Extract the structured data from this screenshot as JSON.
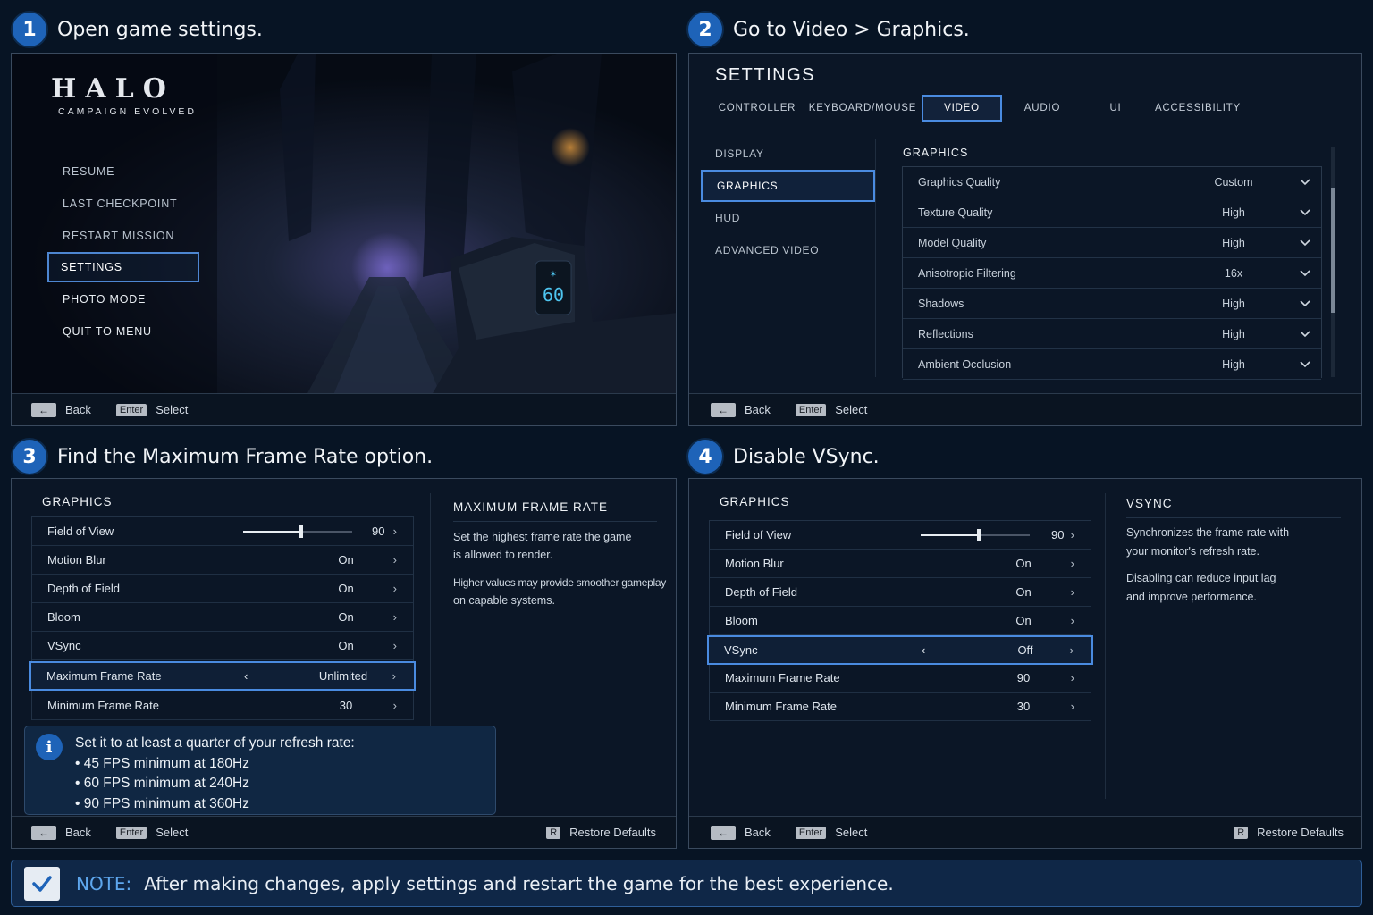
{
  "steps": [
    {
      "num": "1",
      "title": "Open game settings."
    },
    {
      "num": "2",
      "title": "Go to Video > Graphics."
    },
    {
      "num": "3",
      "title": "Find the Maximum Frame Rate option."
    },
    {
      "num": "4",
      "title": "Disable VSync."
    }
  ],
  "footer": {
    "back": "Back",
    "enter_key": "Enter",
    "select": "Select",
    "r_key": "R",
    "restore": "Restore Defaults"
  },
  "panel1": {
    "logo_title": "HALO",
    "logo_sub": "CAMPAIGN EVOLVED",
    "ammo": "60",
    "menu": [
      "RESUME",
      "LAST CHECKPOINT",
      "RESTART MISSION",
      "SETTINGS",
      "PHOTO MODE",
      "QUIT TO MENU"
    ]
  },
  "panel2": {
    "title": "SETTINGS",
    "tabs": [
      "CONTROLLER",
      "KEYBOARD/MOUSE",
      "VIDEO",
      "AUDIO",
      "UI",
      "ACCESSIBILITY"
    ],
    "side": [
      "DISPLAY",
      "GRAPHICS",
      "HUD",
      "ADVANCED VIDEO"
    ],
    "section": "GRAPHICS",
    "rows": [
      {
        "label": "Graphics Quality",
        "value": "Custom"
      },
      {
        "label": "Texture Quality",
        "value": "High"
      },
      {
        "label": "Model Quality",
        "value": "High"
      },
      {
        "label": "Anisotropic Filtering",
        "value": "16x"
      },
      {
        "label": "Shadows",
        "value": "High"
      },
      {
        "label": "Reflections",
        "value": "High"
      },
      {
        "label": "Ambient Occlusion",
        "value": "High"
      }
    ]
  },
  "panel3": {
    "section": "GRAPHICS",
    "rows": [
      {
        "label": "Field of View",
        "value": "90"
      },
      {
        "label": "Motion Blur",
        "value": "On"
      },
      {
        "label": "Depth of Field",
        "value": "On"
      },
      {
        "label": "Bloom",
        "value": "On"
      },
      {
        "label": "VSync",
        "value": "On"
      },
      {
        "label": "Maximum Frame Rate",
        "value": "Unlimited"
      },
      {
        "label": "Minimum Frame Rate",
        "value": "30"
      }
    ],
    "fov_slider_fraction": 0.53,
    "desc_title": "MAXIMUM FRAME RATE",
    "desc_1": "Set the highest frame rate the game",
    "desc_2": "is allowed to render.",
    "desc_3": "Higher values may provide smoother gameplay",
    "desc_4": "on capable systems.",
    "tip_title": "Set it to at least a quarter of your refresh rate:",
    "tips": [
      "• 45 FPS minimum at 180Hz",
      "• 60 FPS minimum at 240Hz",
      "• 90 FPS minimum at 360Hz"
    ]
  },
  "panel4": {
    "section": "GRAPHICS",
    "rows": [
      {
        "label": "Field of View",
        "value": "90"
      },
      {
        "label": "Motion Blur",
        "value": "On"
      },
      {
        "label": "Depth of Field",
        "value": "On"
      },
      {
        "label": "Bloom",
        "value": "On"
      },
      {
        "label": "VSync",
        "value": "Off"
      },
      {
        "label": "Maximum Frame Rate",
        "value": "90"
      },
      {
        "label": "Minimum Frame Rate",
        "value": "30"
      }
    ],
    "fov_slider_fraction": 0.53,
    "desc_title": "VSYNC",
    "desc_1": "Synchronizes the frame rate with",
    "desc_2": "your monitor's refresh rate.",
    "desc_3": "Disabling can reduce input lag",
    "desc_4": "and improve performance."
  },
  "note": {
    "label": "NOTE:",
    "text": "After making changes, apply settings and restart the game for the best experience."
  },
  "colors": {
    "accent": "#4a8be0",
    "badge": "#1e63b8",
    "bg": "#071424"
  }
}
